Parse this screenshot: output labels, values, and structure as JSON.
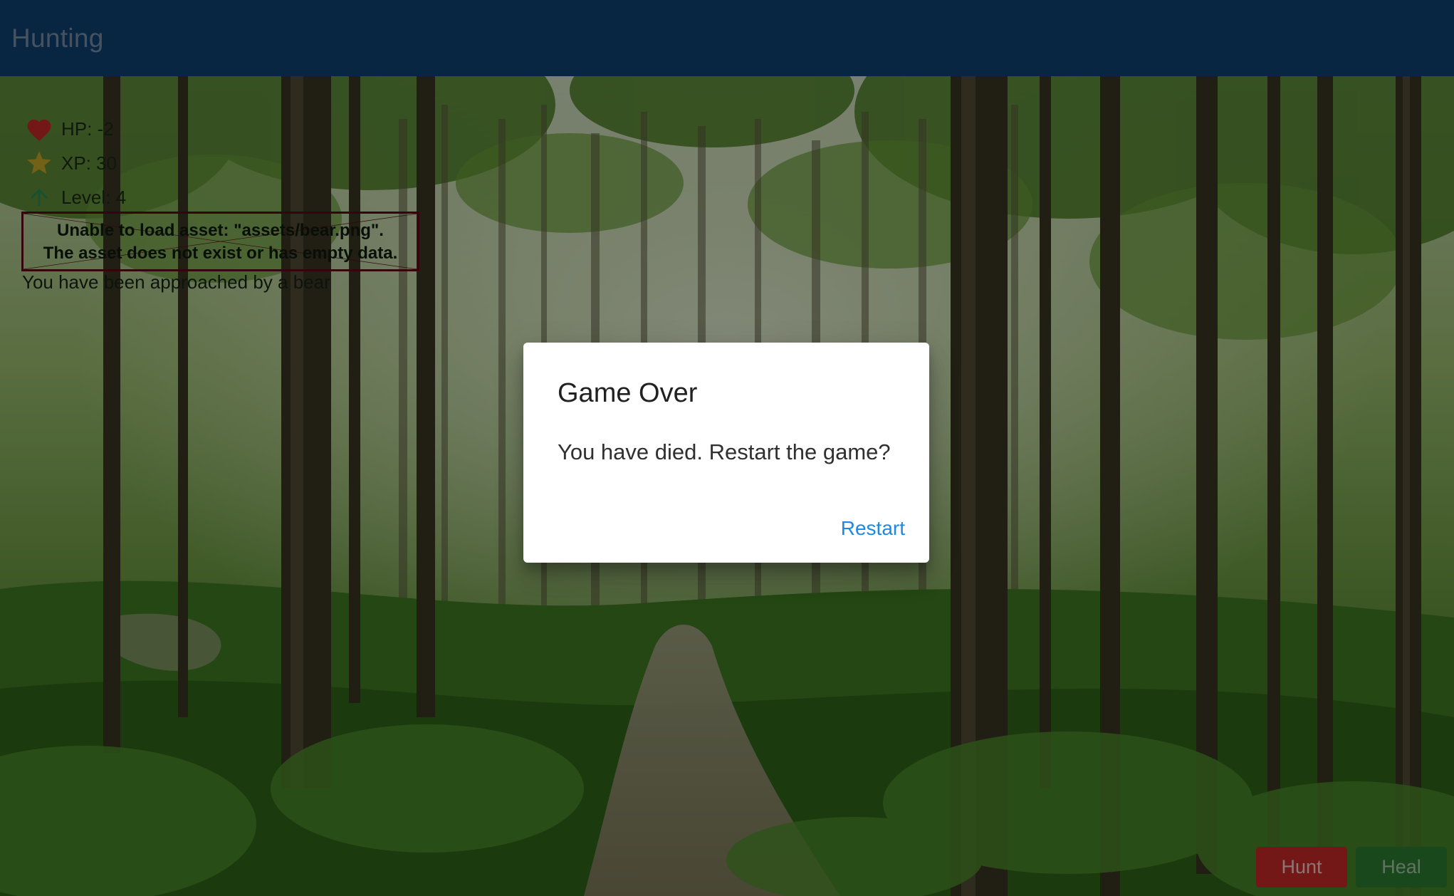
{
  "app_bar": {
    "title": "Hunting"
  },
  "stats": {
    "hp_label": "HP: -2",
    "xp_label": "XP: 30",
    "level_label": "Level: 4"
  },
  "asset_error": {
    "line1": "Unable to load asset: \"assets/bear.png\".",
    "line2": "The asset does not exist or has empty data."
  },
  "encounter": {
    "message": "You have been approached by a bear"
  },
  "actions": {
    "hunt_label": "Hunt",
    "heal_label": "Heal"
  },
  "dialog": {
    "title": "Game Over",
    "message": "You have died. Restart the game?",
    "action_label": "Restart"
  },
  "colors": {
    "app_bar": "#0e4373",
    "hunt_button": "#c62828",
    "heal_button": "#2e7d32",
    "dialog_action": "#1e88e5",
    "heart_icon": "#c62828",
    "star_icon": "#c9a82a",
    "arrow_icon": "#2e8b57"
  },
  "icons": {
    "hp": "heart-icon",
    "xp": "star-icon",
    "level": "arrow-upward-icon"
  }
}
